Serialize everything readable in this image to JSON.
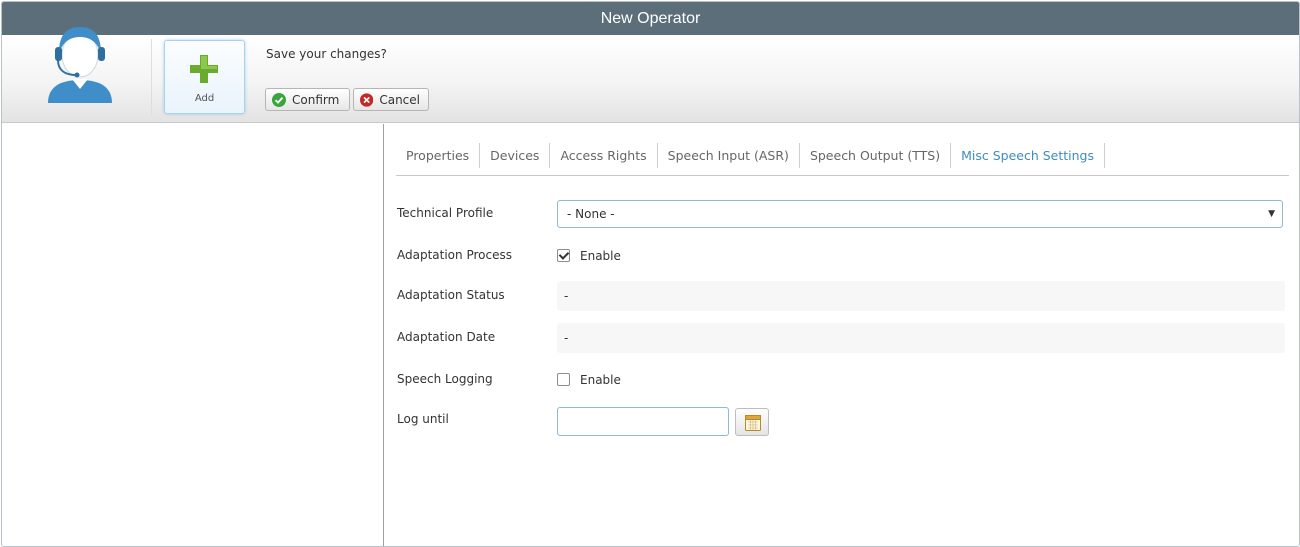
{
  "window": {
    "title": "New Operator"
  },
  "toolbar": {
    "avatar_icon": "operator-headset-icon",
    "add_label": "Add",
    "add_icon": "plus-icon",
    "prompt": "Save your changes?",
    "confirm_label": "Confirm",
    "confirm_icon": "check-circle-icon",
    "cancel_label": "Cancel",
    "cancel_icon": "x-circle-icon"
  },
  "tabs": [
    {
      "label": "Properties",
      "active": false
    },
    {
      "label": "Devices",
      "active": false
    },
    {
      "label": "Access Rights",
      "active": false
    },
    {
      "label": "Speech Input (ASR)",
      "active": false
    },
    {
      "label": "Speech Output (TTS)",
      "active": false
    },
    {
      "label": "Misc Speech Settings",
      "active": true
    }
  ],
  "form": {
    "technical_profile": {
      "label": "Technical Profile",
      "value": "- None -"
    },
    "adaptation_process": {
      "label": "Adaptation Process",
      "checked": true,
      "option_label": "Enable"
    },
    "adaptation_status": {
      "label": "Adaptation Status",
      "value": "-"
    },
    "adaptation_date": {
      "label": "Adaptation Date",
      "value": "-"
    },
    "speech_logging": {
      "label": "Speech Logging",
      "checked": false,
      "option_label": "Enable"
    },
    "log_until": {
      "label": "Log until",
      "value": "",
      "calendar_icon": "calendar-icon"
    }
  },
  "colors": {
    "titlebar": "#5b6e7a",
    "active_tab": "#3d8cc0",
    "confirm_icon": "#3aa53a",
    "cancel_icon": "#c62828",
    "add_icon": "#6aaa2c"
  }
}
